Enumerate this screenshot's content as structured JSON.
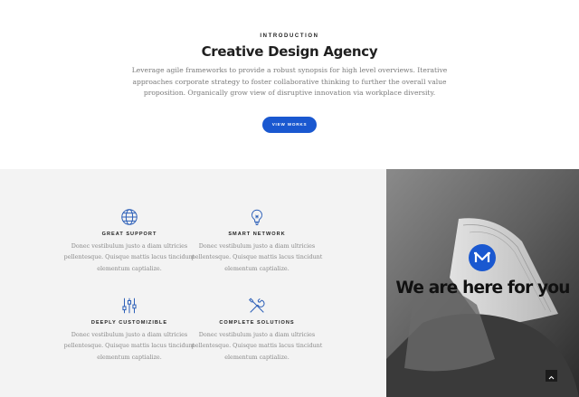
{
  "intro": {
    "eyebrow": "INTRODUCTION",
    "title": "Creative Design Agency",
    "text": "Leverage agile frameworks to provide a robust synopsis for high level overviews. Iterative approaches corporate strategy to foster collaborative thinking to further the overall value proposition. Organically grow view of disruptive innovation via workplace diversity.",
    "button_label": "VIEW WORKS"
  },
  "features": [
    {
      "icon": "globe-icon",
      "title": "GREAT SUPPORT",
      "text": "Donec vestibulum justo a diam ultricies pellentesque. Quisque mattis lacus tincidunt elementum captialize."
    },
    {
      "icon": "lightbulb-icon",
      "title": "SMART NETWORK",
      "text": "Donec vestibulum justo a diam ultricies pellentesque. Quisque mattis lacus tincidunt elementum captialize."
    },
    {
      "icon": "sliders-icon",
      "title": "DEEPLY CUSTOMIZIBLE",
      "text": "Donec vestibulum justo a diam ultricies pellentesque. Quisque mattis lacus tincidunt elementum captialize."
    },
    {
      "icon": "tools-icon",
      "title": "COMPLETE SOLUTIONS",
      "text": "Donec vestibulum justo a diam ultricies pellentesque. Quisque mattis lacus tincidunt elementum captialize."
    }
  ],
  "photo": {
    "headline": "We are here for you",
    "logo": "M"
  },
  "colors": {
    "accent": "#1a58d0",
    "features_bg": "#f3f3f3",
    "icon_stroke": "#2c5fb8"
  }
}
